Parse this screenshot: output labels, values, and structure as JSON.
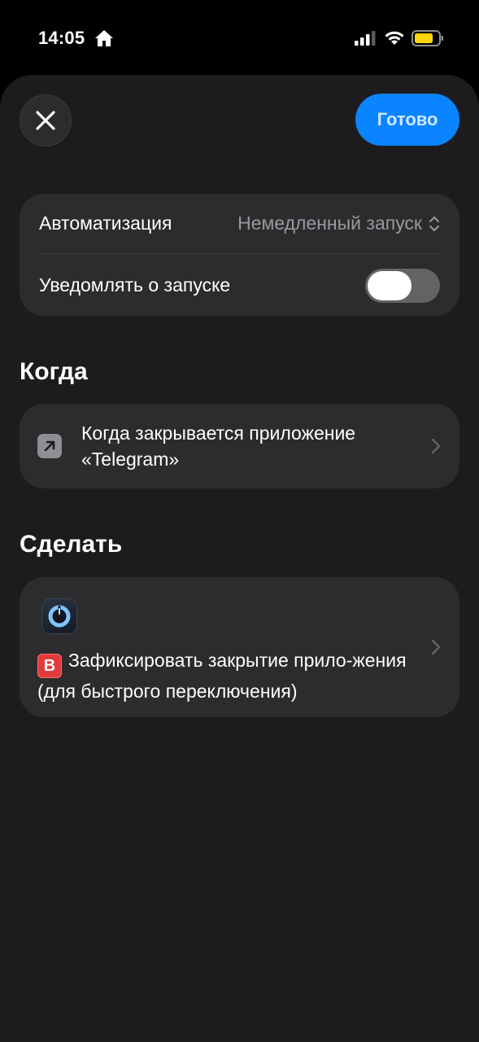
{
  "status_bar": {
    "time": "14:05"
  },
  "header": {
    "done_label": "Готово"
  },
  "settings": {
    "automation_label": "Автоматизация",
    "automation_value": "Немедленный запуск",
    "notify_label": "Уведомлять о запуске",
    "notify_enabled": false
  },
  "when": {
    "title": "Когда",
    "trigger_text": "Когда закрывается приложение «Telegram»"
  },
  "do": {
    "title": "Сделать",
    "badge_letter": "B",
    "action_text": "Зафиксировать закрытие прило-жения (для быстрого переключения)"
  },
  "colors": {
    "accent": "#0a84ff",
    "background": "#1c1c1e",
    "card": "#2c2c2e",
    "badge": "#e33b3b"
  },
  "icons": [
    "home-icon",
    "signal-icon",
    "wifi-icon",
    "battery-icon",
    "close-icon",
    "updown-icon",
    "arrow-up-right-icon",
    "chevron-right-icon",
    "app-icon"
  ]
}
